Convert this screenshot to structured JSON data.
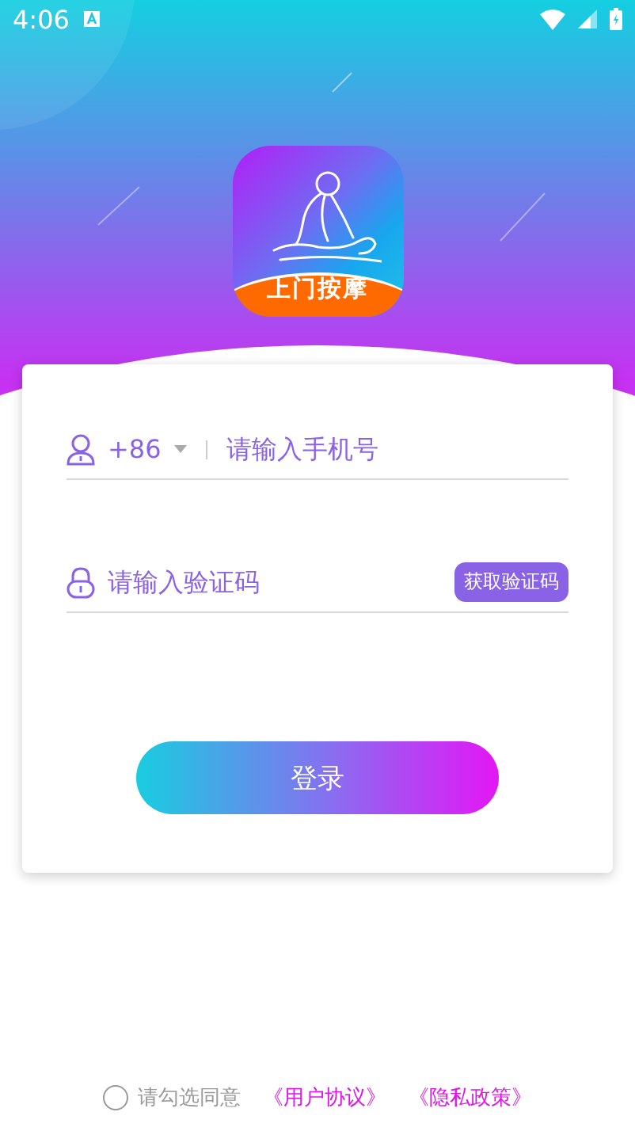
{
  "status_bar": {
    "time": "4:06"
  },
  "app_logo": {
    "name": "上门按摩"
  },
  "phone_field": {
    "country_code": "+86",
    "placeholder": "请输入手机号"
  },
  "code_field": {
    "placeholder": "请输入验证码",
    "send_code_button": "获取验证码"
  },
  "login_button": "登录",
  "agreement": {
    "checked": false,
    "text": "请勾选同意",
    "links": [
      "《用户协议》",
      "《隐私政策》"
    ]
  }
}
